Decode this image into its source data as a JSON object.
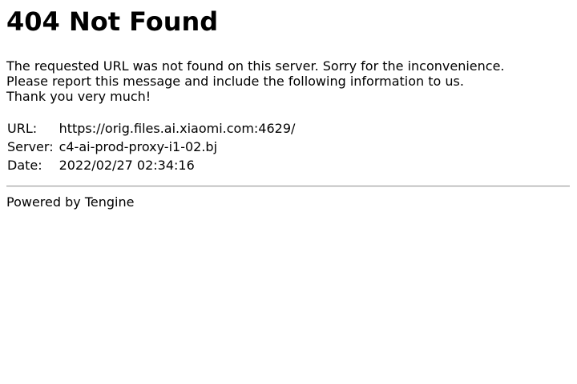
{
  "page": {
    "title": "404 Not Found",
    "message_lines": [
      "The requested URL was not found on this server. Sorry for the inconvenience.",
      "Please report this message and include the following information to us.",
      "Thank you very much!"
    ]
  },
  "info": {
    "rows": [
      {
        "label": "URL:",
        "value": "https://orig.files.ai.xiaomi.com:4629/"
      },
      {
        "label": "Server:",
        "value": "c4-ai-prod-proxy-i1-02.bj"
      },
      {
        "label": "Date:",
        "value": "2022/02/27 02:34:16"
      }
    ]
  },
  "footer": {
    "text": "Powered by Tengine"
  }
}
